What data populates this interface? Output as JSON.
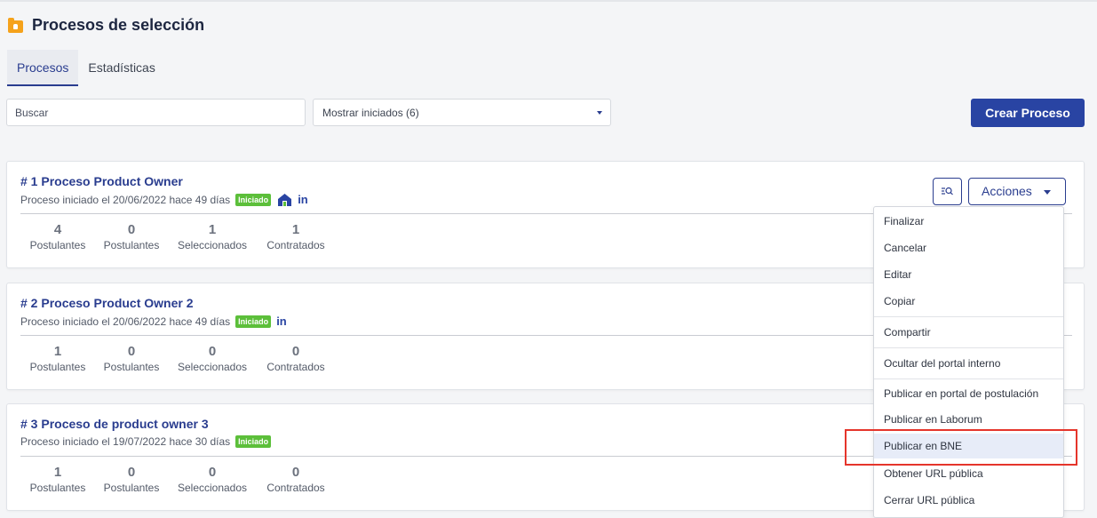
{
  "page": {
    "title": "Procesos de selección"
  },
  "tabs": [
    {
      "label": "Procesos",
      "active": true
    },
    {
      "label": "Estadísticas",
      "active": false
    }
  ],
  "search": {
    "value": "Buscar"
  },
  "filter": {
    "selected": "Mostrar iniciados (6)"
  },
  "create_button": "Crear Proceso",
  "stat_labels": [
    "Postulantes",
    "Postulantes",
    "Seleccionados",
    "Contratados"
  ],
  "processes": [
    {
      "title": "# 1 Proceso Product Owner",
      "subtitle": "Proceso iniciado el 20/06/2022 hace 49 días",
      "badge": "Iniciado",
      "channels": [
        "home-icon",
        "linkedin-icon"
      ],
      "linkedin_text": "in",
      "stats": [
        "4",
        "0",
        "1",
        "1"
      ]
    },
    {
      "title": "# 2 Proceso Product Owner 2",
      "subtitle": "Proceso iniciado el 20/06/2022 hace 49 días",
      "badge": "Iniciado",
      "channels": [
        "linkedin-icon"
      ],
      "linkedin_text": "in",
      "stats": [
        "1",
        "0",
        "0",
        "0"
      ]
    },
    {
      "title": "# 3 Proceso de product owner 3",
      "subtitle": "Proceso iniciado el 19/07/2022 hace 30 días",
      "badge": "Iniciado",
      "channels": [],
      "stats": [
        "1",
        "0",
        "0",
        "0"
      ]
    }
  ],
  "actions_button": "Acciones",
  "actions_menu": [
    "Finalizar",
    "Cancelar",
    "Editar",
    "Copiar",
    "Compartir",
    "Ocultar del portal interno",
    "Publicar en portal de postulación",
    "Publicar en Laborum",
    "Publicar en BNE",
    "Obtener URL pública",
    "Cerrar URL pública"
  ],
  "highlighted_menu_item": "Publicar en BNE",
  "colors": {
    "accent": "#2944a3",
    "badge": "#5cbf3a",
    "folder": "#f5a21b",
    "highlight_box": "#e5352b"
  }
}
